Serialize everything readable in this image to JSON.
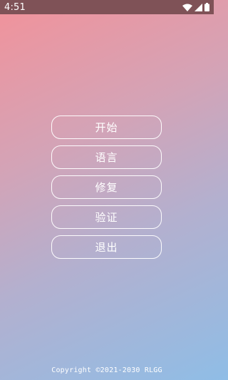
{
  "status_bar": {
    "time": "4:51",
    "icons": [
      "wifi-icon",
      "cellular-signal-icon",
      "battery-icon"
    ],
    "color": "#7f5257"
  },
  "menu": {
    "buttons": [
      {
        "label": "开始"
      },
      {
        "label": "语言"
      },
      {
        "label": "修复"
      },
      {
        "label": "验证"
      },
      {
        "label": "退出"
      }
    ]
  },
  "footer": {
    "copyright": "Copyright ©2021-2030 RLGG"
  },
  "theme": {
    "gradient_start": "#f2929a",
    "gradient_end": "#8fbde6",
    "text_color": "#ffffff"
  }
}
